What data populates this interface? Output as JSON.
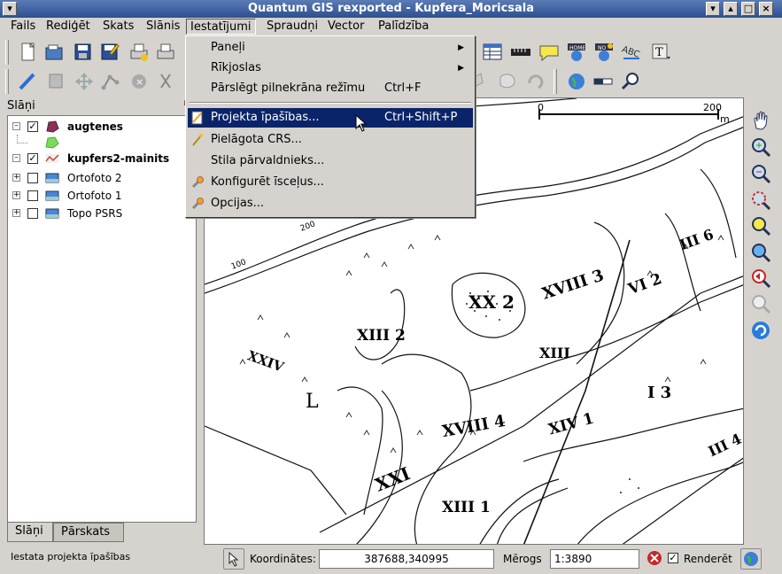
{
  "window": {
    "title": "Quantum GIS rexported - Kupfera_Moricsala"
  },
  "menubar": {
    "items": [
      {
        "label": "Fails"
      },
      {
        "label": "Rediģēt"
      },
      {
        "label": "Skats"
      },
      {
        "label": "Slānis"
      },
      {
        "label": "Iestatījumi"
      },
      {
        "label": "Spraudņi"
      },
      {
        "label": "Vector"
      },
      {
        "label": "Palīdzība"
      }
    ]
  },
  "dropdown": {
    "items": [
      {
        "label": "Paneļi",
        "shortcut": "",
        "submenu": true
      },
      {
        "label": "Rīkjoslas",
        "shortcut": "",
        "submenu": true
      },
      {
        "label": "Pārslēgt pilnekrāna režīmu",
        "shortcut": "Ctrl+F"
      },
      {
        "label": "Projekta īpašības...",
        "shortcut": "Ctrl+Shift+P",
        "highlighted": true
      },
      {
        "label": "Pielāgota CRS...",
        "shortcut": ""
      },
      {
        "label": "Stila pārvaldnieks...",
        "shortcut": ""
      },
      {
        "label": "Konfigurēt īsceļus...",
        "shortcut": ""
      },
      {
        "label": "Opcijas...",
        "shortcut": ""
      }
    ]
  },
  "layers_panel": {
    "title": "Slāņi",
    "layers": [
      {
        "name": "augtenes",
        "checked": true,
        "bold": true,
        "selected": true
      },
      {
        "name": "kupfers2-mainits",
        "checked": true,
        "bold": true
      },
      {
        "name": "Ortofoto 2",
        "checked": false
      },
      {
        "name": "Ortofoto 1",
        "checked": false
      },
      {
        "name": "Topo PSRS",
        "checked": false
      }
    ],
    "tabs": [
      "Slāņi",
      "Pārskats"
    ]
  },
  "map": {
    "scalebar": {
      "start": "0",
      "end": "200",
      "unit": "m"
    },
    "labels": [
      "XX 2",
      "XVIII 3",
      "XIII 2",
      "XXI",
      "XVIII 4",
      "XIII 1",
      "XIV 1",
      "VI 2",
      "III 6",
      "I 3",
      "III 4",
      "XXIV",
      "L",
      "XIII",
      "200",
      "100"
    ]
  },
  "statusbar": {
    "message": "Iestata projekta īpašības",
    "coords_label": "Koordinātes:",
    "coords_value": "387688,340995",
    "scale_label": "Mērogs",
    "scale_value": "1:3890",
    "render_label": "Renderēt",
    "render_checked": true
  }
}
